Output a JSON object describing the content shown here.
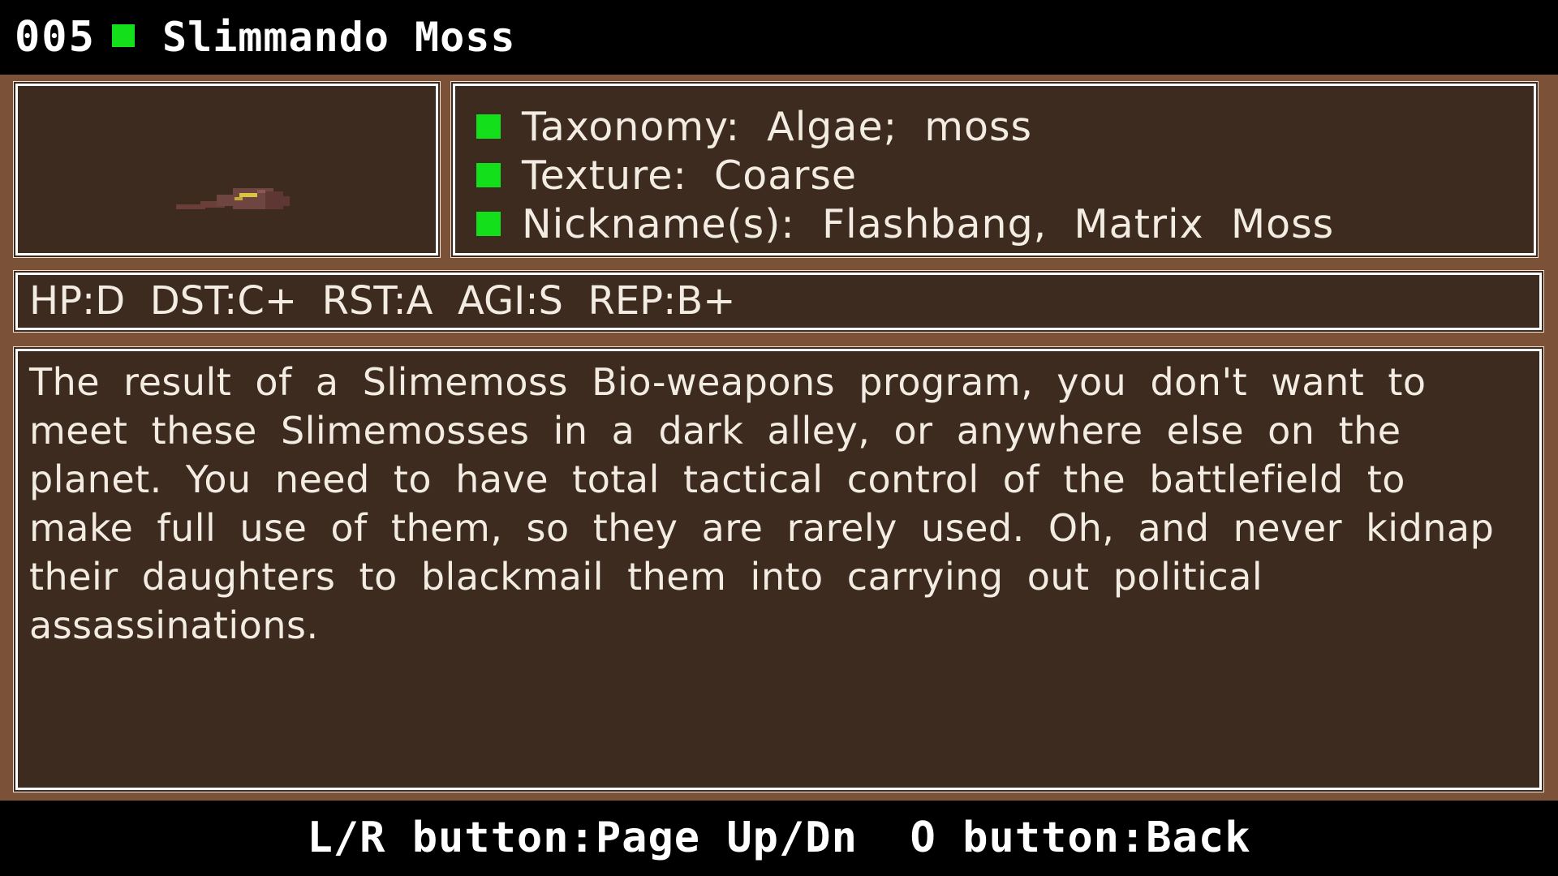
{
  "header": {
    "entry_number": "005",
    "entry_name": "Slimmando Moss"
  },
  "portrait": {
    "sprite": "slime-moss-sprite"
  },
  "info": {
    "rows": [
      {
        "text": "Taxonomy:  Algae;  moss"
      },
      {
        "text": "Texture:  Coarse"
      },
      {
        "text": "Nickname(s):  Flashbang,  Matrix  Moss"
      }
    ]
  },
  "stats": {
    "text": "HP:D  DST:C+  RST:A  AGI:S  REP:B+"
  },
  "description": {
    "text": "The result of a Slimemoss Bio-weapons program, you don't want to meet these Slimemosses in a dark alley, or anywhere else on the planet. You need to have total tactical control of the battlefield to make full use of them, so they are rarely used. Oh, and never kidnap their daughters to blackmail them into carrying out political assassinations."
  },
  "footer": {
    "hint": "L/R button:Page Up/Dn  O button:Back"
  },
  "colors": {
    "background": "#7b5238",
    "panel": "#3d2b1f",
    "accent": "#13e01b",
    "text": "#f3ece2"
  }
}
